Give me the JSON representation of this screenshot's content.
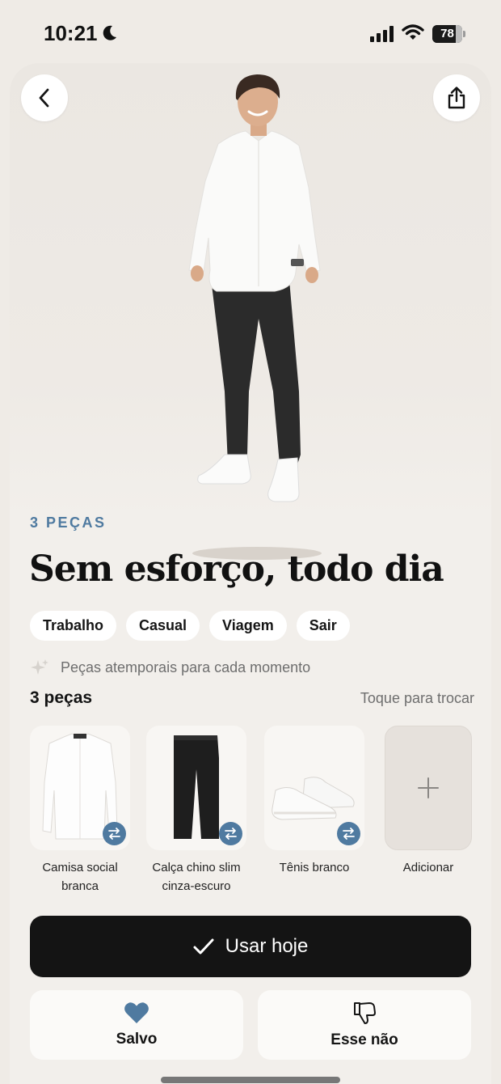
{
  "status_bar": {
    "time": "10:21",
    "battery_level": "78",
    "battery_fraction": 0.78
  },
  "outfit": {
    "count_label": "3 PEÇAS",
    "title": "Sem esforço, todo dia",
    "tags": [
      "Trabalho",
      "Casual",
      "Viagem",
      "Sair"
    ],
    "description": "Peças atemporais para cada momento"
  },
  "pieces": {
    "heading": "3 peças",
    "hint": "Toque para trocar",
    "items": [
      {
        "line1": "Camisa social",
        "line2": "branca"
      },
      {
        "line1": "Calça chino slim",
        "line2": "cinza-escuro"
      },
      {
        "line1": "Tênis branco",
        "line2": ""
      }
    ],
    "add_label": "Adicionar"
  },
  "actions": {
    "use_today": "Usar hoje",
    "saved": "Salvo",
    "not_this": "Esse não"
  },
  "colors": {
    "accent": "#4f7aa0",
    "primary_button": "#141414",
    "background": "#efebe6"
  }
}
